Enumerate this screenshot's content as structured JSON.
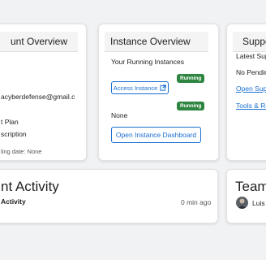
{
  "account_card": {
    "title": "unt Overview",
    "email": "acyberdefense@gmail.c",
    "plan": "t Plan",
    "subscription": "scription",
    "billing_date": "ling date: None"
  },
  "instance_card": {
    "title": "Instance Overview",
    "running_heading": "Your Running Instances",
    "badge_1": "Running",
    "access_button": "Access Instance",
    "badge_2": "Running",
    "none_text": "None",
    "dashboard_button": "Open Instance Dashboard"
  },
  "support_card": {
    "title": "Suppo",
    "latest": "Latest Sup",
    "no_pending": "No Pendin",
    "open_link": "Open Supp",
    "tools_link": "Tools & Re"
  },
  "activity_card": {
    "title": "nt Activity",
    "item_label": "Activity",
    "item_time": "0 min ago"
  },
  "team_card": {
    "title": "Team",
    "member_name": "Luis"
  },
  "icons": {
    "external_link": "external-link-icon",
    "avatar": "avatar"
  },
  "colors": {
    "badge_green": "#2e8540",
    "link_blue": "#1a6fd1",
    "page_bg": "#f1f2f3"
  }
}
